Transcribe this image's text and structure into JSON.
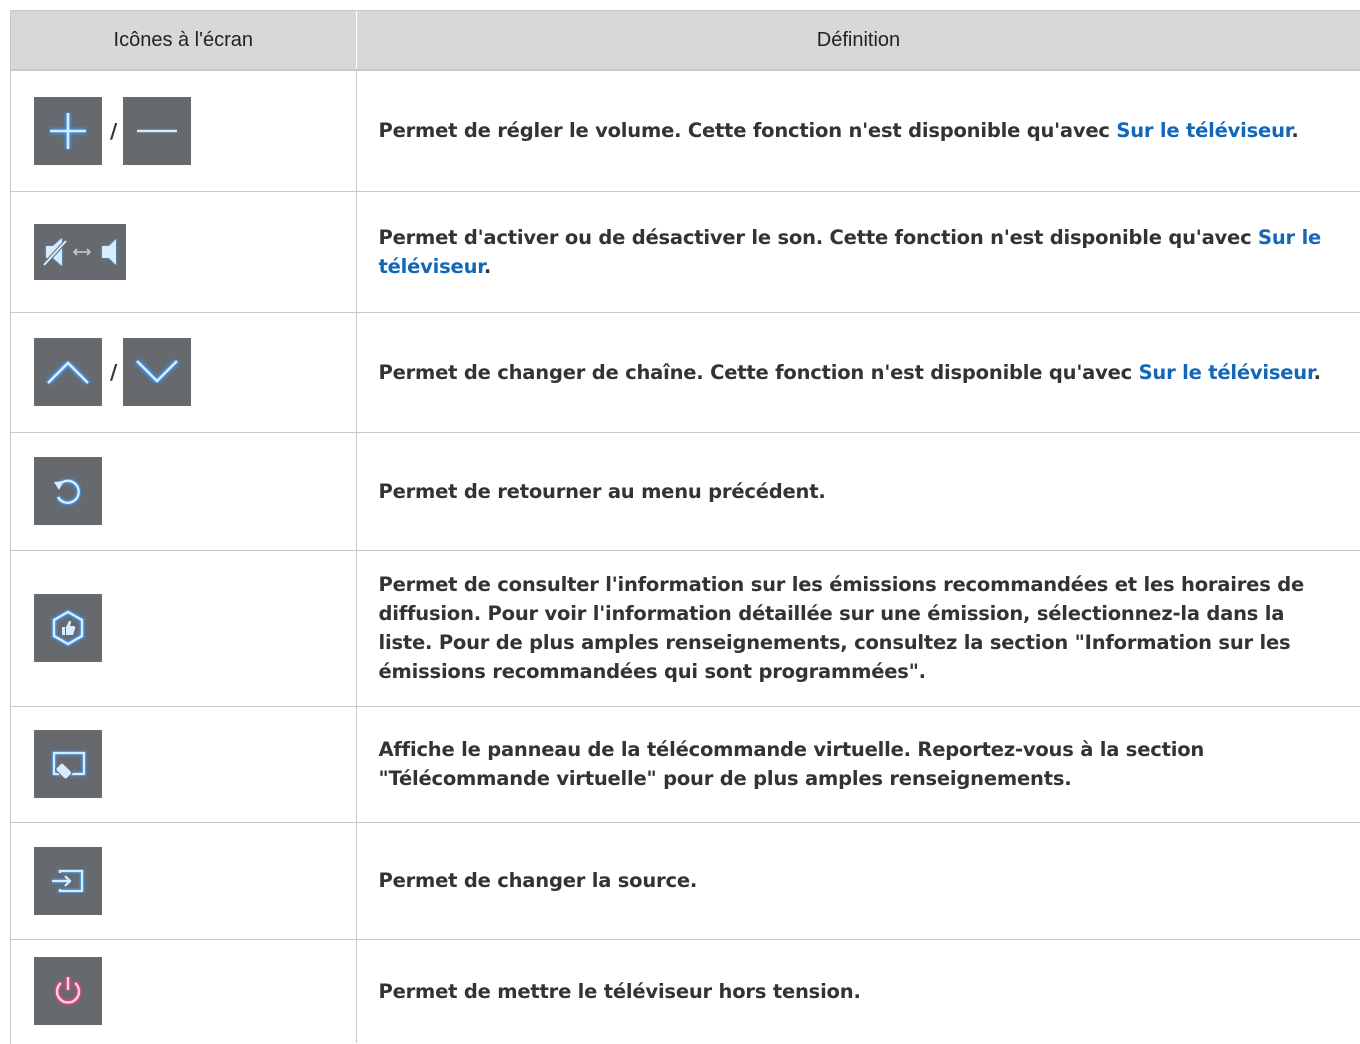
{
  "table": {
    "headers": {
      "icons": "Icônes à l'écran",
      "definition": "Définition"
    },
    "separator": "/",
    "rows": [
      {
        "icons": [
          "plus-icon",
          "minus-icon"
        ],
        "text_before": "Permet de régler le volume. Cette fonction n'est disponible qu'avec ",
        "link": "Sur le téléviseur",
        "text_after": "."
      },
      {
        "icons": [
          "mute-toggle-icon"
        ],
        "text_before": "Permet d'activer ou de désactiver le son. Cette fonction n'est disponible qu'avec ",
        "link": "Sur le téléviseur",
        "text_after": "."
      },
      {
        "icons": [
          "chevron-up-icon",
          "chevron-down-icon"
        ],
        "text_before": "Permet de changer de chaîne. Cette fonction n'est disponible qu'avec ",
        "link": "Sur le téléviseur",
        "text_after": "."
      },
      {
        "icons": [
          "return-icon"
        ],
        "text": "Permet de retourner au menu précédent."
      },
      {
        "icons": [
          "recommended-icon"
        ],
        "text": "Permet de consulter l'information sur les émissions recommandées et les horaires de diffusion. Pour voir l'information détaillée sur une émission, sélectionnez-la dans la liste. Pour de plus amples renseignements, consultez la section \"Information sur les émissions recommandées qui sont programmées\"."
      },
      {
        "icons": [
          "virtual-remote-icon"
        ],
        "text": "Affiche le panneau de la télécommande virtuelle. Reportez-vous à la section \"Télécommande virtuelle\" pour de plus amples renseignements."
      },
      {
        "icons": [
          "source-icon"
        ],
        "text": "Permet de changer la source."
      },
      {
        "icons": [
          "power-icon"
        ],
        "text": "Permet de mettre le téléviseur hors tension."
      }
    ]
  },
  "colors": {
    "link": "#1466b6",
    "tile": "#666a6e",
    "icon_glow": "#3a9cff",
    "power_glow": "#ff3b7a",
    "header_bg": "#d8d8d8"
  }
}
